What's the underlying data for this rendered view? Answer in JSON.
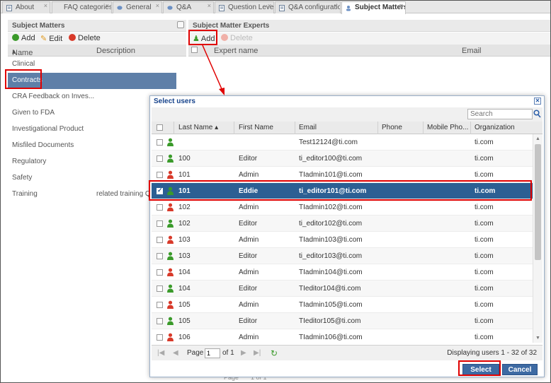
{
  "tabs": [
    {
      "label": "About"
    },
    {
      "label": "FAQ categories"
    },
    {
      "label": "General"
    },
    {
      "label": "Q&A"
    },
    {
      "label": "Question Level"
    },
    {
      "label": "Q&A configuration"
    },
    {
      "label": "Subject Matters"
    }
  ],
  "left": {
    "header": "Subject Matters",
    "add_label": "Add",
    "edit_label": "Edit",
    "delete_label": "Delete",
    "col_name": "Name",
    "col_desc": "Description",
    "rows": [
      {
        "name": "Clinical",
        "desc": ""
      },
      {
        "name": "Contracts",
        "desc": ""
      },
      {
        "name": "CRA Feedback on Inves...",
        "desc": ""
      },
      {
        "name": "Given to FDA",
        "desc": ""
      },
      {
        "name": "Investigational Product",
        "desc": ""
      },
      {
        "name": "Misfiled Documents",
        "desc": ""
      },
      {
        "name": "Regulatory",
        "desc": ""
      },
      {
        "name": "Safety",
        "desc": ""
      },
      {
        "name": "Training",
        "desc": "related training Qs"
      }
    ]
  },
  "right": {
    "header": "Subject Matter Experts",
    "add_label": "Add",
    "delete_label": "Delete",
    "col_expert": "Expert name",
    "col_email": "Email",
    "pager_text": "Page",
    "pager_of": "1 of 1"
  },
  "dialog": {
    "title": "Select users",
    "search_placeholder": "Search",
    "columns": [
      "Last Name",
      "First Name",
      "Email",
      "Phone",
      "Mobile Pho...",
      "Organization"
    ],
    "rows": [
      {
        "last": "",
        "first": "",
        "email": "Test12124@ti.com",
        "org": "ti.com",
        "color": "green",
        "checked": false
      },
      {
        "last": "100",
        "first": "Editor",
        "email": "ti_editor100@ti.com",
        "org": "ti.com",
        "color": "green",
        "checked": false
      },
      {
        "last": "101",
        "first": "Admin",
        "email": "TIadmin101@ti.com",
        "org": "ti.com",
        "color": "red",
        "checked": false
      },
      {
        "last": "101",
        "first": "Eddie",
        "email": "ti_editor101@ti.com",
        "org": "ti.com",
        "color": "green",
        "checked": true
      },
      {
        "last": "102",
        "first": "Admin",
        "email": "TIadmin102@ti.com",
        "org": "ti.com",
        "color": "red",
        "checked": false
      },
      {
        "last": "102",
        "first": "Editor",
        "email": "ti_editor102@ti.com",
        "org": "ti.com",
        "color": "green",
        "checked": false
      },
      {
        "last": "103",
        "first": "Admin",
        "email": "TIadmin103@ti.com",
        "org": "ti.com",
        "color": "red",
        "checked": false
      },
      {
        "last": "103",
        "first": "Editor",
        "email": "ti_editor103@ti.com",
        "org": "ti.com",
        "color": "green",
        "checked": false
      },
      {
        "last": "104",
        "first": "Admin",
        "email": "TIadmin104@ti.com",
        "org": "ti.com",
        "color": "red",
        "checked": false
      },
      {
        "last": "104",
        "first": "Editor",
        "email": "TIeditor104@ti.com",
        "org": "ti.com",
        "color": "green",
        "checked": false
      },
      {
        "last": "105",
        "first": "Admin",
        "email": "TIadmin105@ti.com",
        "org": "ti.com",
        "color": "red",
        "checked": false
      },
      {
        "last": "105",
        "first": "Editor",
        "email": "TIeditor105@ti.com",
        "org": "ti.com",
        "color": "green",
        "checked": false
      },
      {
        "last": "106",
        "first": "Admin",
        "email": "TIadmin106@ti.com",
        "org": "ti.com",
        "color": "red",
        "checked": false
      }
    ],
    "pager": {
      "page_label": "Page",
      "page_value": "1",
      "of_label": "of 1",
      "displaying": "Displaying users 1 - 32 of 32"
    },
    "select_label": "Select",
    "cancel_label": "Cancel"
  },
  "colors": {
    "selected_row": "#2c5f93",
    "highlight": "#e00000",
    "user_active": "#3a9a2a",
    "user_admin": "#d83a2a"
  }
}
